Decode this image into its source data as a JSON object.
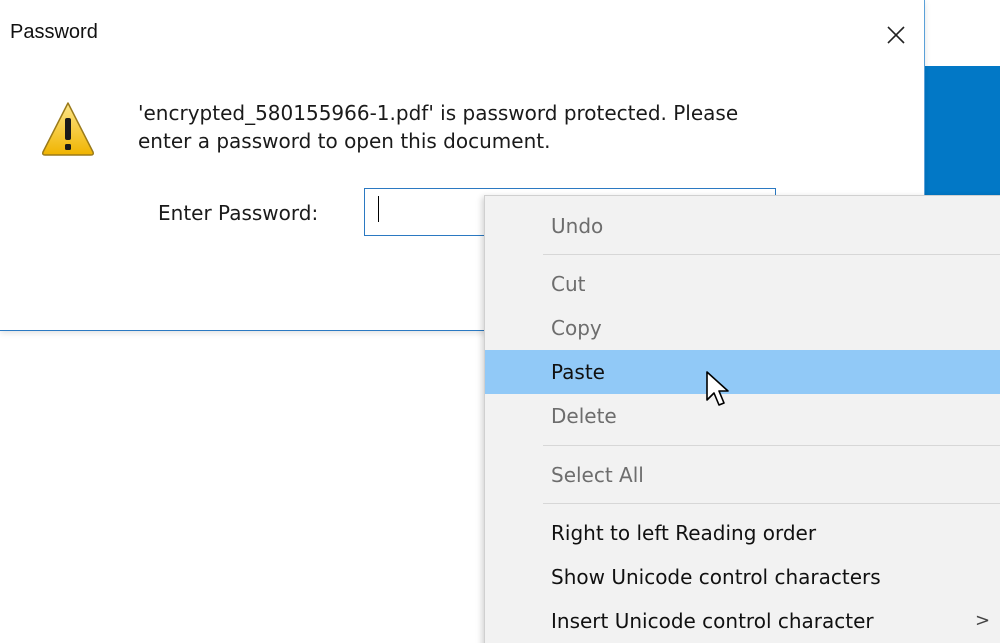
{
  "dialog": {
    "title": "Password",
    "close_icon": "close-icon",
    "warning_icon": "warning-icon",
    "message_line1": "'encrypted_580155966-1.pdf' is password protected. Please",
    "message_line2": "enter a password to open this document.",
    "password_label": "Enter Password:",
    "password_value": ""
  },
  "context_menu": {
    "items": [
      {
        "label": "Undo",
        "enabled": false
      },
      {
        "label": "Cut",
        "enabled": false
      },
      {
        "label": "Copy",
        "enabled": false
      },
      {
        "label": "Paste",
        "enabled": true,
        "highlighted": true
      },
      {
        "label": "Delete",
        "enabled": false
      },
      {
        "label": "Select All",
        "enabled": false
      },
      {
        "label": "Right to left Reading order",
        "enabled": true
      },
      {
        "label": "Show Unicode control characters",
        "enabled": true
      },
      {
        "label": "Insert Unicode control character",
        "enabled": true,
        "submenu_glyph": ">"
      }
    ]
  },
  "colors": {
    "accent_blue": "#0278c6",
    "menu_highlight": "#91c9f7",
    "disabled_text": "#6d6d6d",
    "warning_yellow": "#f5c400"
  }
}
